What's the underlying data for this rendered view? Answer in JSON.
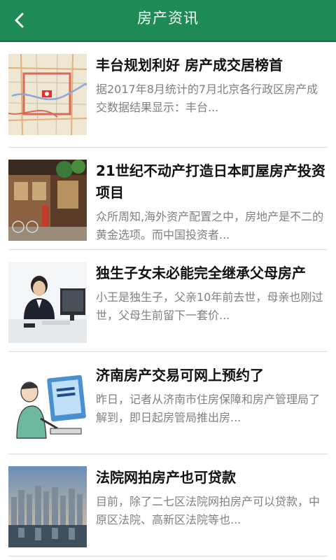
{
  "header": {
    "title": "房产资讯",
    "back_icon": "chevron-left-icon",
    "background": "#1e8a55"
  },
  "articles": [
    {
      "title": "丰台规划利好 房产成交居榜首",
      "summary": "据2017年8月统计的7月北京各行政区房产成交数据结果显示：丰台..."
    },
    {
      "title": "21世纪不动产打造日本町屋房产投资项目",
      "summary": "众所周知,海外资产配置之中，房地产是不二的黄金选项。而中国投资者..."
    },
    {
      "title": "独生子女未必能完全继承父母房产",
      "summary": "小王是独生子，父亲10年前去世，母亲也刚过世，父母生前留下一套价..."
    },
    {
      "title": "济南房产交易可网上预约了",
      "summary": "昨日，记者从济南市住房保障和房产管理局了解到，即日起房管局推出房..."
    },
    {
      "title": "法院网拍房产也可贷款",
      "summary": "目前，除了二七区法院网拍房产可以贷款，中原区法院、高新区法院等也..."
    }
  ]
}
